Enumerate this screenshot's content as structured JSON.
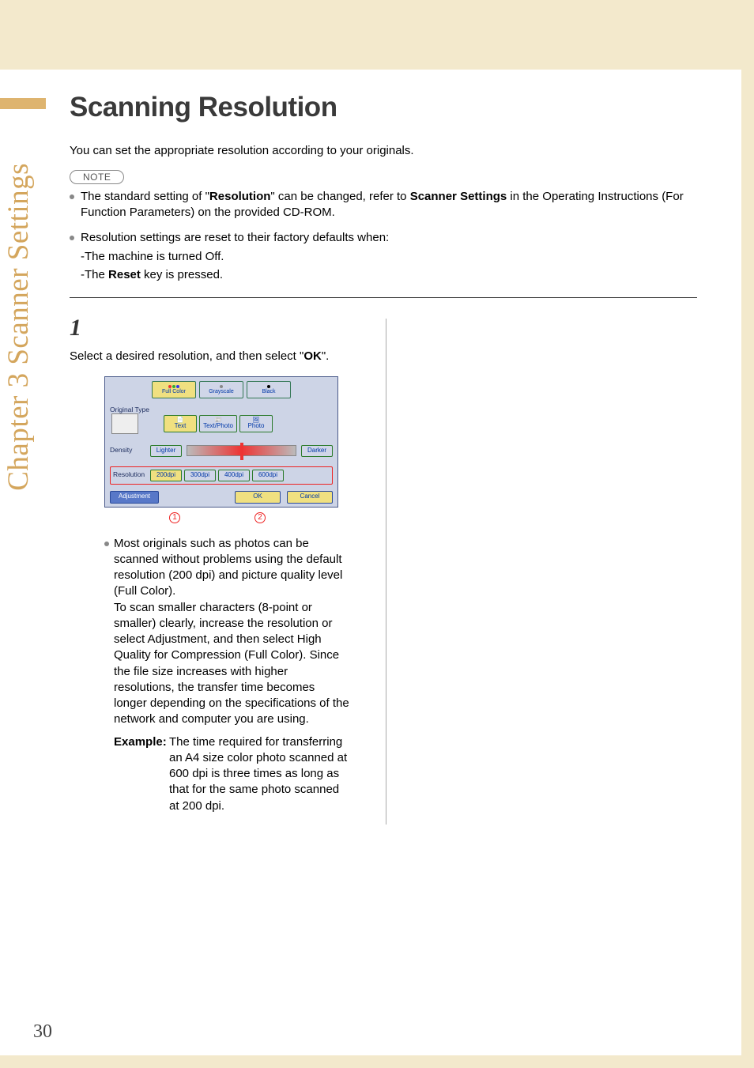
{
  "sidebar": {
    "chapter_label": "Chapter 3   Scanner Settings"
  },
  "title": "Scanning Resolution",
  "intro": "You can set the appropriate resolution according to your originals.",
  "note_label": "NOTE",
  "notes": {
    "n1": {
      "pre": "The standard setting of \"",
      "bold1": "Resolution",
      "mid": "\" can be changed, refer to ",
      "bold2": "Scanner Settings",
      "post": " in the Operating Instructions (For Function Parameters) on the provided CD-ROM."
    },
    "n2": {
      "line": "Resolution settings are reset to their factory defaults when:",
      "sub1_pre": "-The machine is turned Off.",
      "sub2_pre": "-The ",
      "sub2_bold": "Reset",
      "sub2_post": " key is pressed."
    }
  },
  "step": {
    "num": "1",
    "text_pre": "Select a desired resolution, and then select \"",
    "text_bold": "OK",
    "text_post": "\"."
  },
  "screenshot": {
    "tabs": {
      "full_color": "Full Color",
      "grayscale": "Grayscale",
      "black": "Black"
    },
    "orig_label": "Original Type",
    "orig": {
      "text": "Text",
      "textphoto": "Text/Photo",
      "photo": "Photo"
    },
    "density_label": "Density",
    "lighter": "Lighter",
    "darker": "Darker",
    "res_label": "Resolution",
    "res": {
      "r200": "200dpi",
      "r300": "300dpi",
      "r400": "400dpi",
      "r600": "600dpi"
    },
    "adjustment": "Adjustment",
    "ok": "OK",
    "cancel": "Cancel"
  },
  "callouts": {
    "c1": "1",
    "c2": "2"
  },
  "bullet": {
    "p1": "Most originals such as photos can be scanned without problems using the default resolution (200 dpi) and picture quality level (Full Color).",
    "p2": "To scan smaller characters (8-point or smaller) clearly, increase the resolution or select Adjustment, and then select High Quality for Compression (Full Color). Since the file size increases with higher resolutions, the transfer time becomes longer depending on the specifications of the network and computer you are using."
  },
  "example": {
    "label": "Example:",
    "text": " The time required for transferring an A4 size color photo scanned at 600 dpi is three times as long as that for the same photo scanned at 200 dpi."
  },
  "page_number": "30"
}
